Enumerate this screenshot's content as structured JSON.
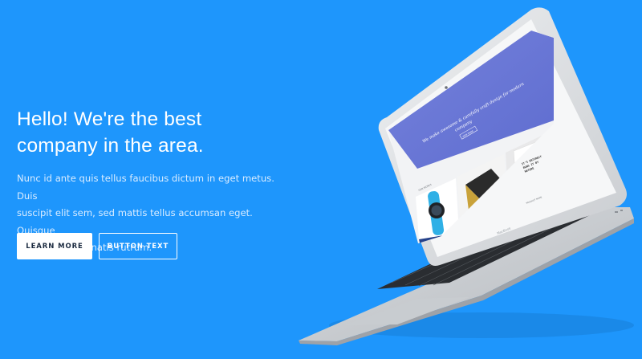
{
  "hero": {
    "title_line1": "Hello! We're the best",
    "title_line2": "company in the area.",
    "description_line1": "Nunc id ante quis tellus faucibus dictum in eget metus. Duis",
    "description_line2": "suscipit elit sem, sed mattis tellus accumsan eget. Quisque",
    "description_line3": "consequat venenatis rutrum."
  },
  "buttons": {
    "learn_more": "LEARN MORE",
    "button_text": "BUTTON TEXT"
  },
  "laptop_screen": {
    "headline_line1": "We make awesome & carefully craft design for modern",
    "headline_line2": "company",
    "cta": "VIEW MORE",
    "section_label": "OUR WORKS",
    "card_text_line1": "IT'S ENTIRELY",
    "card_text_line2": "RUNS IT BY",
    "card_text_line3": "NATURE",
    "card_caption": "PRODUCT NAME",
    "tablet_brand": "MacBook"
  },
  "colors": {
    "background": "#1e96fc",
    "screen_banner": "#6b79d6",
    "button_text": "#1c2b40"
  }
}
